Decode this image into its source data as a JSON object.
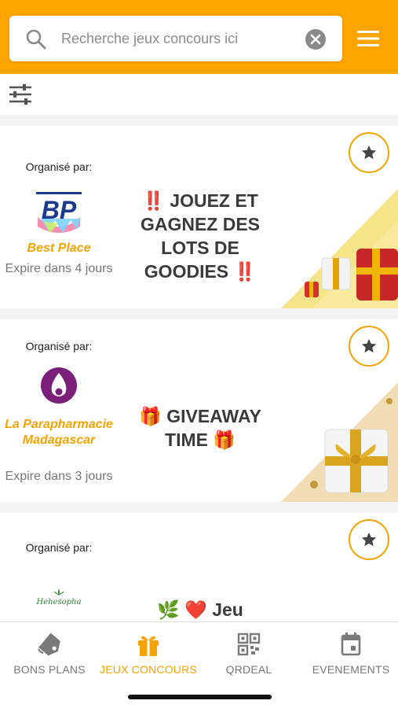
{
  "search": {
    "placeholder": "Recherche jeux concours ici"
  },
  "icons": {
    "search": "search-icon",
    "clear": "close-circle-icon",
    "menu": "hamburger-menu-icon",
    "filter": "sliders-filter-icon",
    "favorite": "star-icon"
  },
  "colors": {
    "accent": "#ffa500",
    "org_name": "#f5a300",
    "title": "#3a3a3a"
  },
  "cards": [
    {
      "organizer_label": "Organisé par:",
      "organizer_name": "Best Place",
      "logo_text": "BP",
      "expire": "Expire dans 4 jours",
      "title_lines": [
        "‼️ JOUEZ ET",
        "GAGNEZ DES",
        "LOTS DE",
        "GOODIES ‼️"
      ]
    },
    {
      "organizer_label": "Organisé par:",
      "organizer_name": "La Parapharmacie Madagascar",
      "expire": "Expire dans 3 jours",
      "title_lines": [
        "🎁 GIVEAWAY",
        "TIME 🎁"
      ]
    },
    {
      "organizer_label": "Organisé par:",
      "organizer_name": "",
      "logo_text": "Hehesopha",
      "title_lines": [
        "🌿 ❤️ Jeu"
      ]
    }
  ],
  "nav": {
    "items": [
      {
        "label": "BONS PLANS",
        "icon": "tag-icon",
        "active": false
      },
      {
        "label": "JEUX CONCOURS",
        "icon": "gift-icon",
        "active": true
      },
      {
        "label": "QRDEAL",
        "icon": "qr-code-icon",
        "active": false
      },
      {
        "label": "EVENEMENTS",
        "icon": "calendar-icon",
        "active": false
      }
    ]
  }
}
